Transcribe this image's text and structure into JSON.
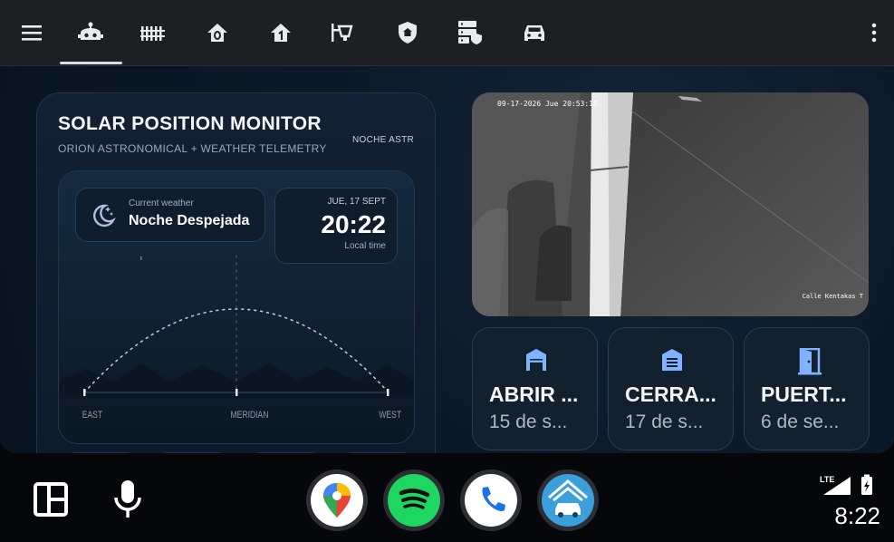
{
  "topbar": {
    "tabs": [
      {
        "name": "menu-icon"
      },
      {
        "name": "robot-icon"
      },
      {
        "name": "fence-icon"
      },
      {
        "name": "home-zero-icon"
      },
      {
        "name": "home-one-icon"
      },
      {
        "name": "outdoor-lamp-icon"
      },
      {
        "name": "home-shield-icon"
      },
      {
        "name": "server-security-icon"
      },
      {
        "name": "car-icon"
      },
      {
        "name": "more-vertical-icon"
      }
    ],
    "active_tab": "robot-icon"
  },
  "solar": {
    "title": "SOLAR POSITION MONITOR",
    "subtitle": "ORION ASTRONOMICAL + WEATHER TELEMETRY",
    "mode": "NOCHE ASTR",
    "weather_caption": "Current weather",
    "weather_value": "Noche Despejada",
    "date": "JUE, 17 SEPT",
    "time": "20:22",
    "time_caption": "Local time",
    "axis": {
      "east": "EAST",
      "meridian": "MERIDIAN",
      "west": "WEST"
    }
  },
  "camera": {
    "timestamp": "09-17-2026 Jue 20:53:18",
    "location": "Calle Kentakas T"
  },
  "tiles": [
    {
      "name": "ABRIR ...",
      "sub": "15 de s...",
      "icon": "garage-open-icon"
    },
    {
      "name": "CERRA...",
      "sub": "17 de s...",
      "icon": "garage-closed-icon"
    },
    {
      "name": "PUERT...",
      "sub": "6 de se...",
      "icon": "door-icon"
    }
  ],
  "bottombar": {
    "apps": [
      "maps-app-icon",
      "spotify-app-icon",
      "phone-app-icon",
      "home-assistant-app-icon"
    ],
    "network": "LTE",
    "clock": "8:22"
  },
  "colors": {
    "accent_blue": "#7fb3ff",
    "card_bg": "#13212f",
    "spotify_green": "#1ed760"
  }
}
